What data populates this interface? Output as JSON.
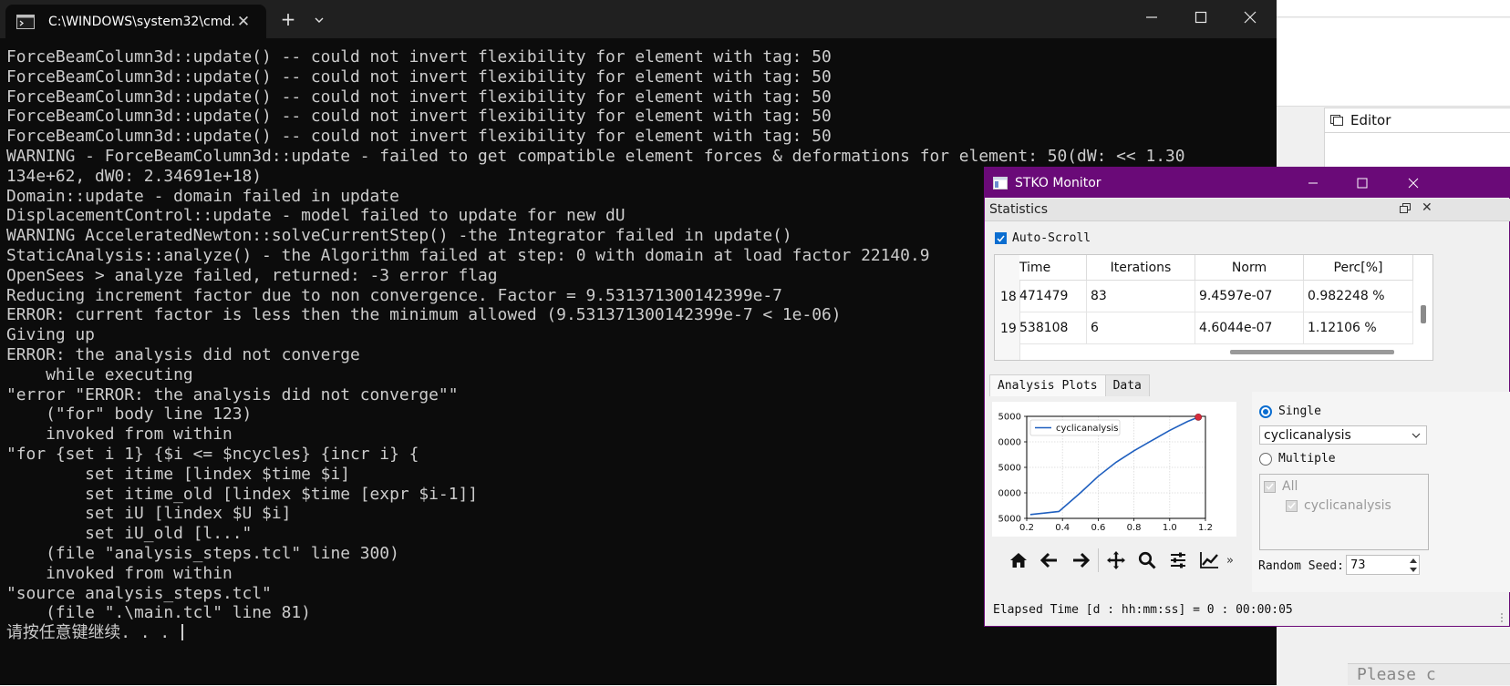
{
  "terminal": {
    "tab_title": "C:\\WINDOWS\\system32\\cmd.",
    "new_tab": "+",
    "lines": [
      "ForceBeamColumn3d::update() -- could not invert flexibility for element with tag: 50",
      "ForceBeamColumn3d::update() -- could not invert flexibility for element with tag: 50",
      "ForceBeamColumn3d::update() -- could not invert flexibility for element with tag: 50",
      "ForceBeamColumn3d::update() -- could not invert flexibility for element with tag: 50",
      "ForceBeamColumn3d::update() -- could not invert flexibility for element with tag: 50",
      "WARNING - ForceBeamColumn3d::update - failed to get compatible element forces & deformations for element: 50(dW: << 1.30",
      "134e+62, dW0: 2.34691e+18)",
      "Domain::update - domain failed in update",
      "DisplacementControl::update - model failed to update for new dU",
      "WARNING AcceleratedNewton::solveCurrentStep() -the Integrator failed in update()",
      "StaticAnalysis::analyze() - the Algorithm failed at step: 0 with domain at load factor 22140.9",
      "OpenSees > analyze failed, returned: -3 error flag",
      "Reducing increment factor due to non convergence. Factor = 9.531371300142399e-7",
      "ERROR: current factor is less then the minimum allowed (9.531371300142399e-7 < 1e-06)",
      "Giving up",
      "ERROR: the analysis did not converge",
      "    while executing",
      "\"error \"ERROR: the analysis did not converge\"\"",
      "    (\"for\" body line 123)",
      "    invoked from within",
      "\"for {set i 1} {$i <= $ncycles} {incr i} {",
      "        set itime [lindex $time $i]",
      "        set itime_old [lindex $time [expr $i-1]]",
      "        set iU [lindex $U $i]",
      "        set iU_old [l...\"",
      "    (file \"analysis_steps.tcl\" line 300)",
      "    invoked from within",
      "\"source analysis_steps.tcl\"",
      "    (file \".\\main.tcl\" line 81)",
      "请按任意键继续. . . "
    ]
  },
  "background_app": {
    "editor_tab": "Editor",
    "please_text": "Please c"
  },
  "stko": {
    "title": "STKO Monitor",
    "statistics_title": "Statistics",
    "auto_scroll_label": "Auto-Scroll",
    "auto_scroll_checked": true,
    "table": {
      "columns": [
        "Time",
        "Iterations",
        "Norm",
        "Perc[%]"
      ],
      "rows": [
        {
          "num": "18",
          "time": "471479",
          "iterations": "83",
          "norm": "9.4597e-07",
          "perc": "0.982248 %"
        },
        {
          "num": "19",
          "time": "538108",
          "iterations": "6",
          "norm": "4.6044e-07",
          "perc": "1.12106 %"
        }
      ]
    },
    "tabs": [
      "Analysis Plots",
      "Data"
    ],
    "active_tab": "Analysis Plots",
    "toolbar_more": "»",
    "single_label": "Single",
    "multiple_label": "Multiple",
    "selected_analysis": "cyclicanalysis",
    "group_all": "All",
    "group_item": "cyclicanalysis",
    "random_seed_label": "Random Seed:",
    "random_seed_value": "73",
    "elapsed_time": "Elapsed Time [d : hh:mm:ss] = 0 : 00:00:05",
    "colors": {
      "titlebar": "#6a0a78",
      "accent": "#0a6dd0",
      "series": "#1f5fbf",
      "marker": "#d62b3c"
    }
  },
  "chart_data": {
    "type": "line",
    "x_ticks": [
      "0.2",
      "0.4",
      "0.6",
      "0.8",
      "1.0",
      "1.2"
    ],
    "y_ticks": [
      "5000",
      "0000",
      "5000",
      "0000",
      "5000"
    ],
    "xlim": [
      0.2,
      1.2
    ],
    "ylim": [
      0,
      4
    ],
    "grid": true,
    "legend_position": "top-left",
    "series": [
      {
        "name": "cyclicanalysis",
        "x": [
          0.22,
          0.38,
          0.5,
          0.6,
          0.7,
          0.8,
          0.9,
          1.0,
          1.1,
          1.16
        ],
        "y": [
          0.15,
          0.27,
          1.0,
          1.65,
          2.2,
          2.65,
          3.05,
          3.45,
          3.8,
          3.97
        ]
      }
    ],
    "marker": {
      "x": 1.16,
      "y": 3.97
    }
  }
}
